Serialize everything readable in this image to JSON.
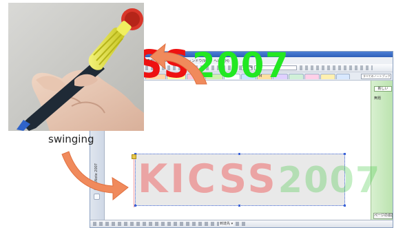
{
  "caption": {
    "swinging": "swinging"
  },
  "app": {
    "menu": [
      "表示(V)",
      "ツール(T)",
      "ウィンドウ(W)",
      "ヘルプ(H)"
    ],
    "zoom": "100%",
    "tabs": [
      "Sy",
      "ve",
      "Co",
      "M"
    ],
    "tab_search": "すべてのノートブックを検索",
    "left_panel_label": "OneNote 2007",
    "right_panel_button": "新しい",
    "right_panel_label": "無題",
    "right_panel_bottom": "ページの追加",
    "bottom_status": "到達先 ▾"
  },
  "ink": {
    "main_letters": "KICSS",
    "main_year": "2007",
    "ghost_letters": "KICSS",
    "ghost_year": "2007"
  },
  "colors": {
    "ink_red": "#ee1111",
    "ink_green": "#22e822",
    "arrow_fill": "#f08a5c",
    "pen_body_yellow": "#e4e23a",
    "pen_cap_red": "#d9362a",
    "pen_barrel_black": "#1f2a36"
  }
}
